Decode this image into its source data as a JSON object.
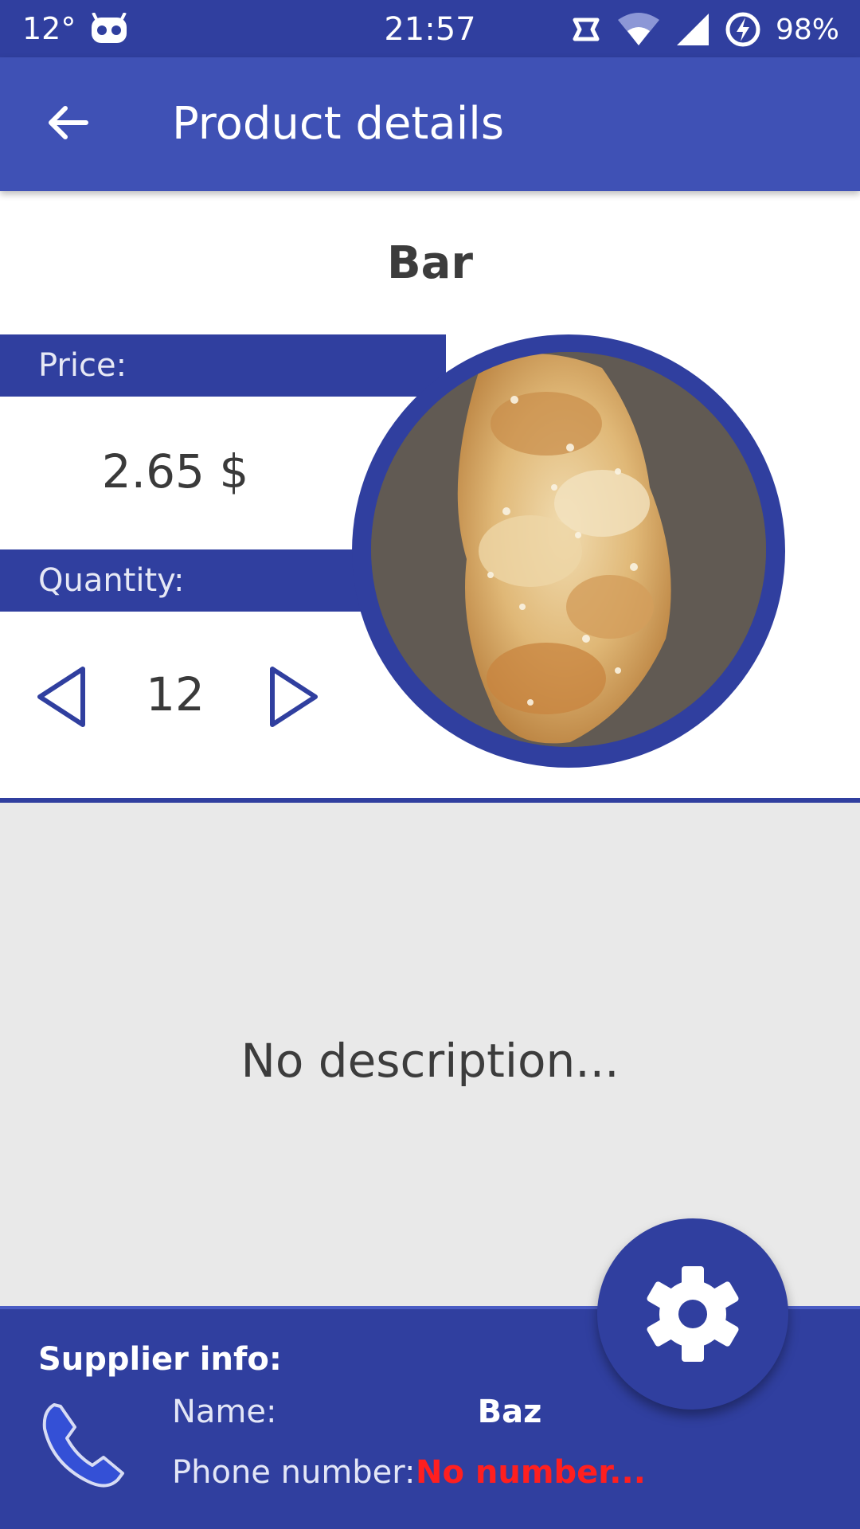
{
  "status_bar": {
    "temperature": "12°",
    "time": "21:57",
    "battery": "98%",
    "icons": [
      "weather-icon",
      "cyanogen-robot-icon",
      "rotate-icon",
      "wifi-icon",
      "cell-signal-icon",
      "battery-charging-icon"
    ]
  },
  "app_bar": {
    "title": "Product details",
    "back_icon": "arrow-left-icon"
  },
  "product": {
    "name": "Bar",
    "price_label": "Price:",
    "price_value": "2.65 $",
    "quantity_label": "Quantity:",
    "quantity_value": "12",
    "decrease_icon": "triangle-left-outline-icon",
    "increase_icon": "triangle-right-outline-icon",
    "image": "bread-photo"
  },
  "description": {
    "text": "No description..."
  },
  "supplier": {
    "title": "Supplier info:",
    "name_label": "Name:",
    "name_value": "Baz",
    "phone_label": "Phone number:",
    "phone_value": "No number...",
    "phone_icon": "phone-icon"
  },
  "fab": {
    "icon": "gear-icon"
  },
  "colors": {
    "primary": "#3f51b5",
    "primary_dark": "#303f9f",
    "error_red": "#ff1f1f",
    "description_bg": "#e9e9e9"
  }
}
